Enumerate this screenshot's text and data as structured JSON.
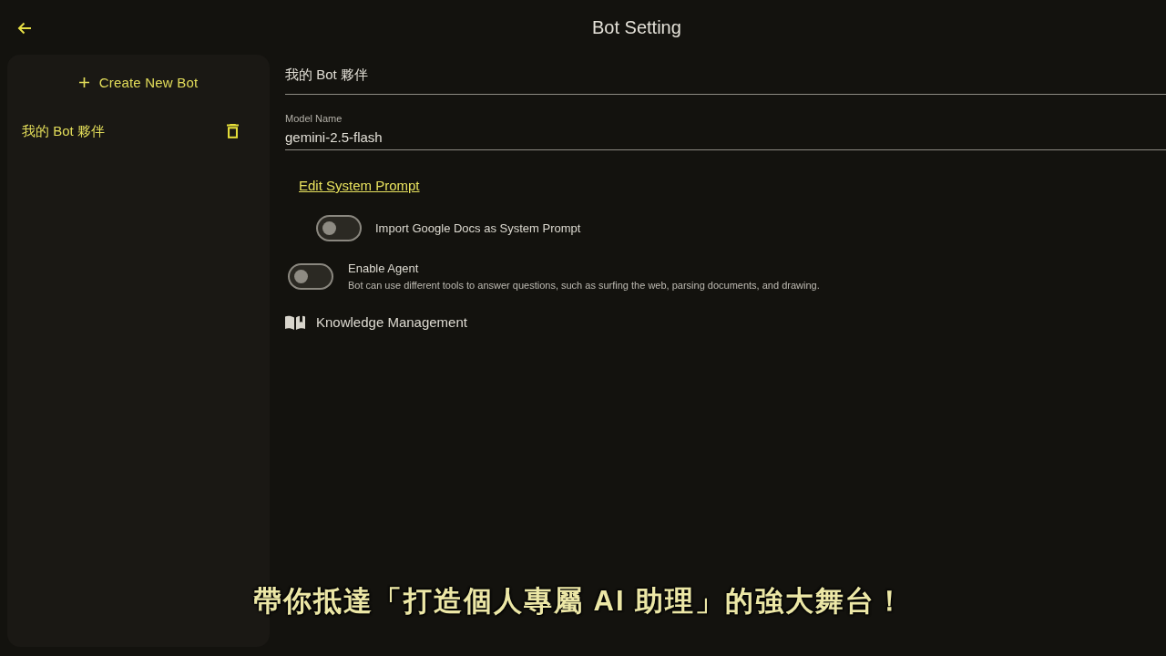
{
  "header": {
    "title": "Bot Setting"
  },
  "sidebar": {
    "create_button": {
      "label": "Create New Bot"
    },
    "bots": [
      {
        "name": "我的 Bot 夥伴"
      }
    ]
  },
  "form": {
    "bot_name": {
      "value": "我的 Bot 夥伴"
    },
    "model_name": {
      "label": "Model Name",
      "value": "gemini-2.5-flash"
    },
    "edit_prompt_link": "Edit System Prompt",
    "toggles": [
      {
        "kind": "nested",
        "label": "Import Google Docs as System Prompt",
        "on": false
      },
      {
        "kind": "described",
        "label": "Enable Agent",
        "description": "Bot can use different tools to answer questions, such as surfing the web, parsing documents, and drawing.",
        "on": false
      }
    ],
    "knowledge_link": "Knowledge Management"
  },
  "subtitle": "帶你抵達「打造個人專屬 AI 助理」的強大舞台！"
}
